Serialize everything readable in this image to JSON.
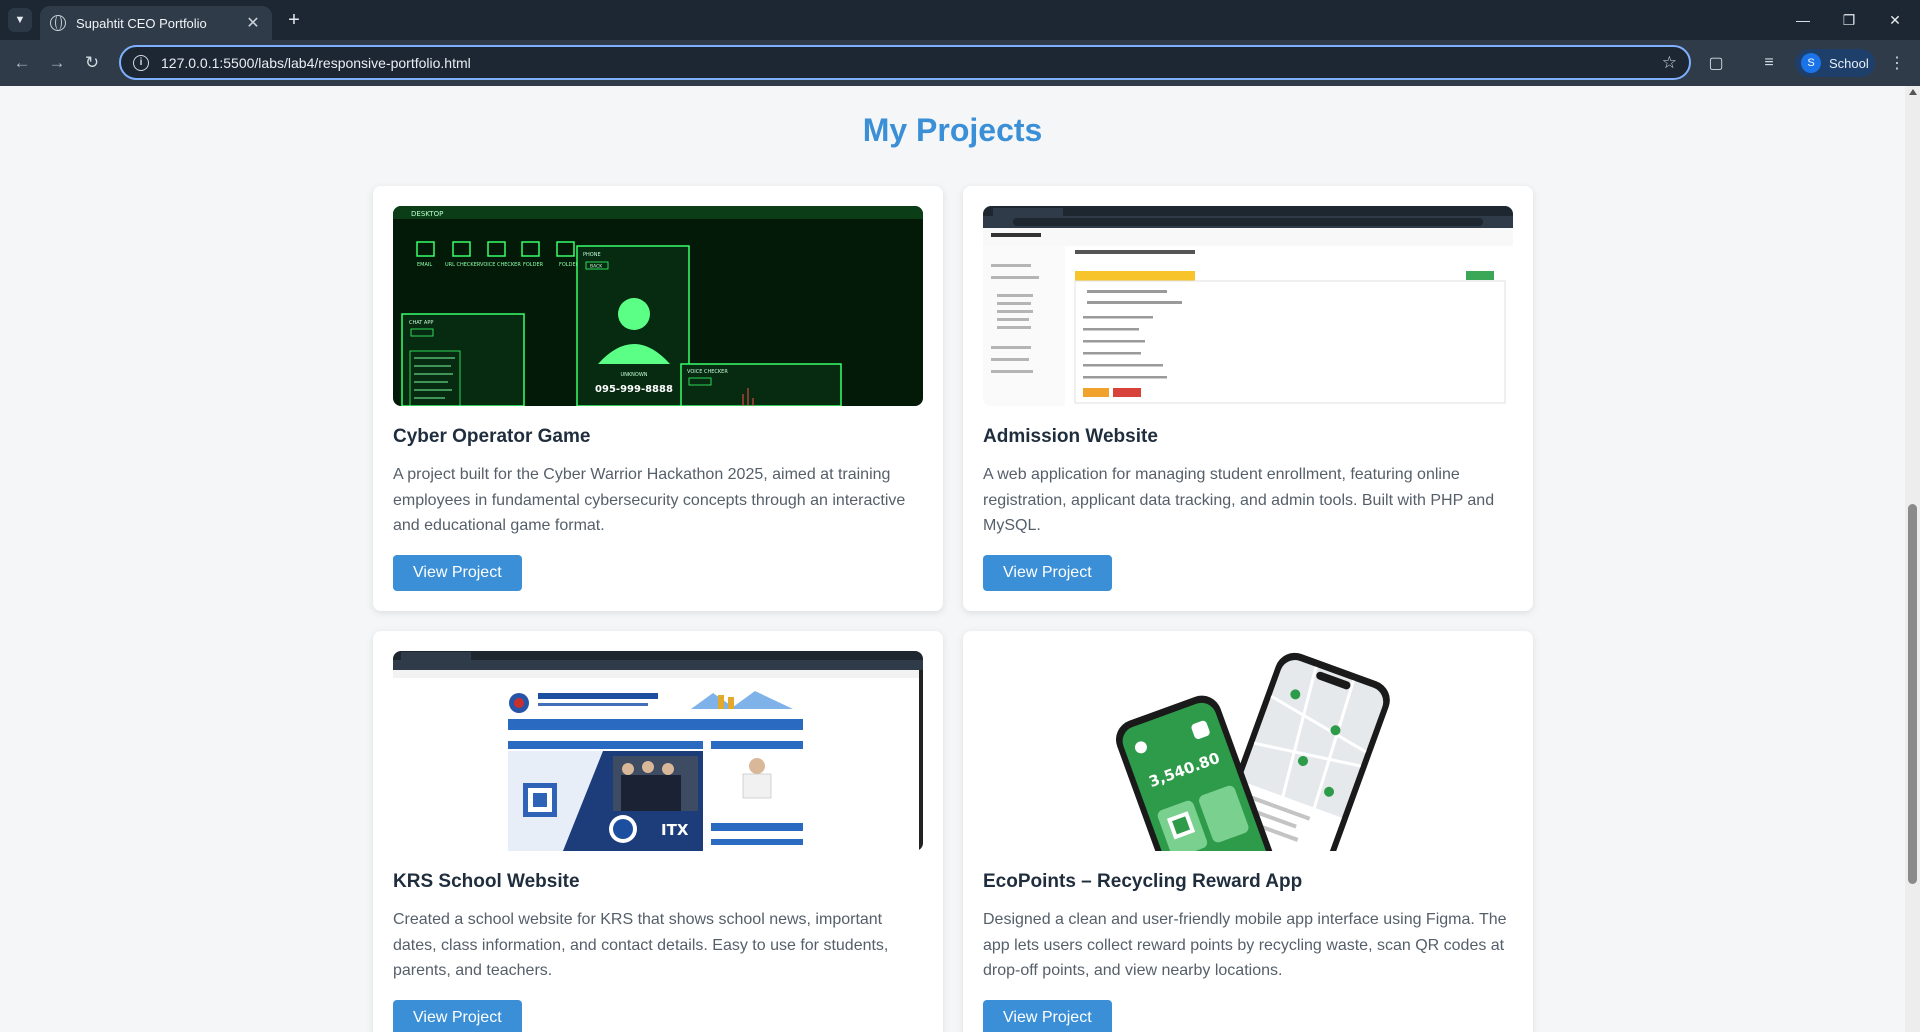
{
  "browser": {
    "tab_title": "Supahtit CEO Portfolio",
    "url": "127.0.0.1:5500/labs/lab4/responsive-portfolio.html",
    "profile_initial": "S",
    "profile_label": "School"
  },
  "section": {
    "title": "My Projects"
  },
  "projects": [
    {
      "title": "Cyber Operator Game",
      "description": "A project built for the Cyber Warrior Hackathon 2025, aimed at training employees in fundamental cybersecurity concepts through an interactive and educational game format.",
      "button_label": "View Project",
      "thumb": {
        "desktop_label": "DESKTOP",
        "icons": [
          "EMAIL",
          "URL CHECKER",
          "VOICE CHECKER",
          "FOLDER",
          "FOLDER"
        ],
        "phone_title": "PHONE",
        "back_label": "BACK",
        "caller_label": "UNKNOWN",
        "phone_number": "095-999-8888",
        "chat_title": "CHAT APP",
        "voice_title": "VOICE CHECKER"
      }
    },
    {
      "title": "Admission Website",
      "description": "A web application for managing student enrollment, featuring online registration, applicant data tracking, and admin tools. Built with PHP and MySQL.",
      "button_label": "View Project"
    },
    {
      "title": "KRS School Website",
      "description": "Created a school website for KRS that shows school news, important dates, class information, and contact details. Easy to use for students, parents, and teachers.",
      "button_label": "View Project",
      "thumb": {
        "badge": "ITX"
      }
    },
    {
      "title": "EcoPoints – Recycling Reward App",
      "description": "Designed a clean and user-friendly mobile app interface using Figma. The app lets users collect reward points by recycling waste, scan QR codes at drop-off points, and view nearby locations.",
      "button_label": "View Project",
      "thumb": {
        "points": "3,540.80"
      }
    }
  ],
  "colors": {
    "accent": "#3a8fd6",
    "neon": "#39ff6a",
    "eco_green": "#2e9b4a"
  }
}
